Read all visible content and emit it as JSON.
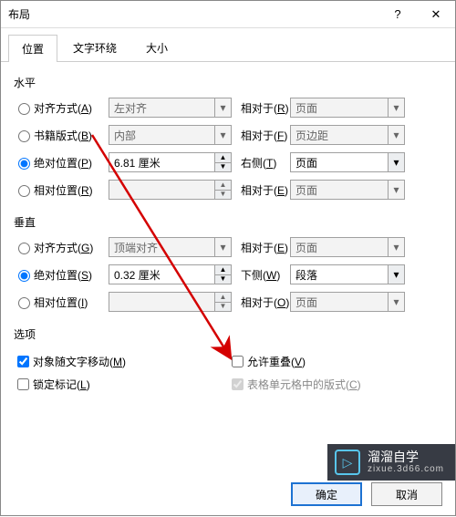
{
  "window": {
    "title": "布局",
    "help": "?",
    "close": "✕"
  },
  "tabs": {
    "position": "位置",
    "wrap": "文字环绕",
    "size": "大小"
  },
  "sections": {
    "horizontal": "水平",
    "vertical": "垂直",
    "options": "选项"
  },
  "hrows": {
    "align": {
      "label_pre": "对齐方式(",
      "key": "A",
      "label_post": ")",
      "value": "左对齐",
      "rel_pre": "相对于(",
      "rel_key": "R",
      "rel_post": ")",
      "rel_value": "页面"
    },
    "book": {
      "label_pre": "书籍版式(",
      "key": "B",
      "label_post": ")",
      "value": "内部",
      "rel_pre": "相对于(",
      "rel_key": "F",
      "rel_post": ")",
      "rel_value": "页边距"
    },
    "abs": {
      "label_pre": "绝对位置(",
      "key": "P",
      "label_post": ")",
      "value": "6.81 厘米",
      "rel_pre": "右侧(",
      "rel_key": "T",
      "rel_post": ")",
      "rel_value": "页面"
    },
    "rel": {
      "label_pre": "相对位置(",
      "key": "R",
      "label_post": ")",
      "value": "",
      "rel_pre": "相对于(",
      "rel_key": "E",
      "rel_post": ")",
      "rel_value": "页面"
    }
  },
  "vrows": {
    "align": {
      "label_pre": "对齐方式(",
      "key": "G",
      "label_post": ")",
      "value": "顶端对齐",
      "rel_pre": "相对于(",
      "rel_key": "E",
      "rel_post": ")",
      "rel_value": "页面"
    },
    "abs": {
      "label_pre": "绝对位置(",
      "key": "S",
      "label_post": ")",
      "value": "0.32 厘米",
      "rel_pre": "下侧(",
      "rel_key": "W",
      "rel_post": ")",
      "rel_value": "段落"
    },
    "rel": {
      "label_pre": "相对位置(",
      "key": "I",
      "label_post": ")",
      "value": "",
      "rel_pre": "相对于(",
      "rel_key": "O",
      "rel_post": ")",
      "rel_value": "页面"
    }
  },
  "options": {
    "move_with_text": {
      "pre": "对象随文字移动(",
      "key": "M",
      "post": ")"
    },
    "lock_anchor": {
      "pre": "锁定标记(",
      "key": "L",
      "post": ")"
    },
    "allow_overlap": {
      "pre": "允许重叠(",
      "key": "V",
      "post": ")"
    },
    "table_cell": {
      "pre": "表格单元格中的版式(",
      "key": "C",
      "post": ")"
    }
  },
  "buttons": {
    "ok": "确定",
    "cancel": "取消"
  },
  "watermark": {
    "brand": "溜溜自学",
    "url": "zixue.3d66.com",
    "icon": "▷"
  }
}
